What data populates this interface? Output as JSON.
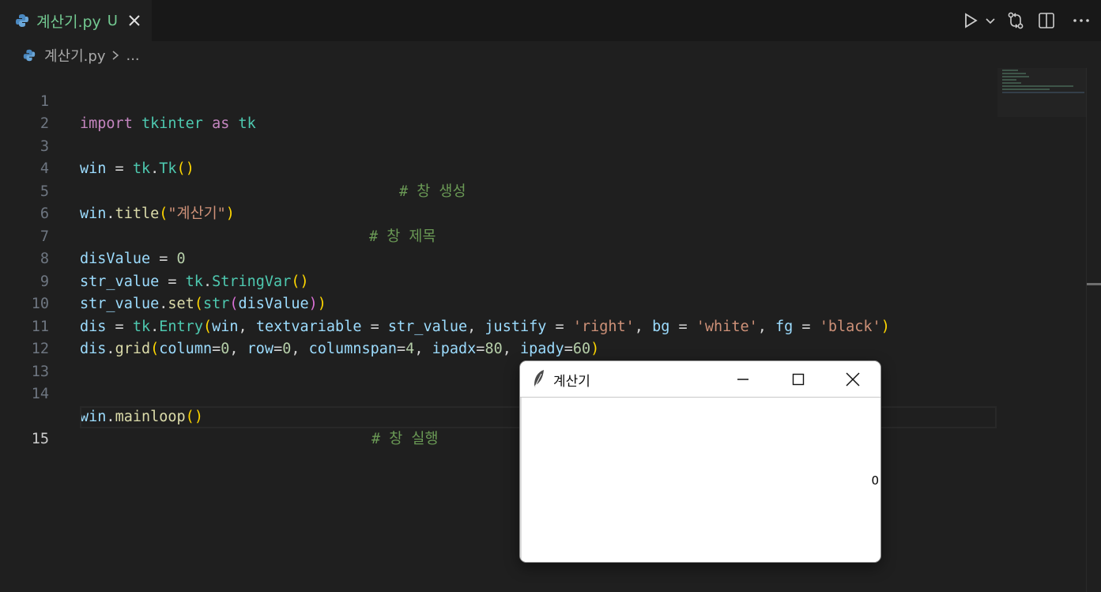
{
  "tab": {
    "filename": "계산기.py",
    "status": "U"
  },
  "breadcrumb": {
    "filename": "계산기.py",
    "more": "..."
  },
  "line_numbers": [
    "1",
    "2",
    "3",
    "4",
    "5",
    "6",
    "7",
    "8",
    "9",
    "10",
    "11",
    "12",
    "13",
    "14",
    "15"
  ],
  "code": {
    "l1": {
      "import": "import",
      "tkinter": "tkinter",
      "as": "as",
      "tk": "tk"
    },
    "l3": {
      "win": "win",
      "eq": " = ",
      "tk": "tk",
      "dot": ".",
      "Tk": "Tk",
      "open": "(",
      "close": ")",
      "comment": "# 창 생성"
    },
    "l5": {
      "win": "win",
      "dot": ".",
      "title": "title",
      "open": "(",
      "str": "\"계산기\"",
      "close": ")",
      "comment": "# 창 제목"
    },
    "l7": {
      "name": "disValue",
      "eq": " = ",
      "num": "0"
    },
    "l8": {
      "name": "str_value",
      "eq": " = ",
      "tk": "tk",
      "dot": ".",
      "cls": "StringVar",
      "open": "(",
      "close": ")"
    },
    "l9": {
      "name": "str_value",
      "dot": ".",
      "set": "set",
      "open": "(",
      "str": "str",
      "open2": "(",
      "arg": "disValue",
      "close2": ")",
      "close": ")"
    },
    "l10": {
      "dis": "dis",
      "eq": " = ",
      "tk": "tk",
      "dot": ".",
      "entry": "Entry",
      "open": "(",
      "win": "win",
      "c1": ", ",
      "textvariable": "textvariable",
      "e1": " = ",
      "str_value": "str_value",
      "c2": ", ",
      "justify": "justify",
      "e2": " = ",
      "right": "'right'",
      "c3": ", ",
      "bg": "bg",
      "e3": " = ",
      "white": "'white'",
      "c4": ", ",
      "fg": "fg",
      "e4": " = ",
      "black": "'black'",
      "close": ")"
    },
    "l11": {
      "dis": "dis",
      "dot": ".",
      "grid": "grid",
      "open": "(",
      "column": "column",
      "eq1": "=",
      "v1": "0",
      "c1": ", ",
      "row": "row",
      "eq2": "=",
      "v2": "0",
      "c2": ", ",
      "columnspan": "columnspan",
      "eq3": "=",
      "v3": "4",
      "c3": ", ",
      "ipadx": "ipadx",
      "eq4": "=",
      "v4": "80",
      "c4": ", ",
      "ipady": "ipady",
      "eq5": "=",
      "v5": "60",
      "close": ")"
    },
    "l14": {
      "win": "win",
      "dot": ".",
      "mainloop": "mainloop",
      "open": "(",
      "close": ")",
      "comment": "# 창 실행"
    }
  },
  "tk_window": {
    "title": "계산기",
    "entry_value": "0"
  }
}
